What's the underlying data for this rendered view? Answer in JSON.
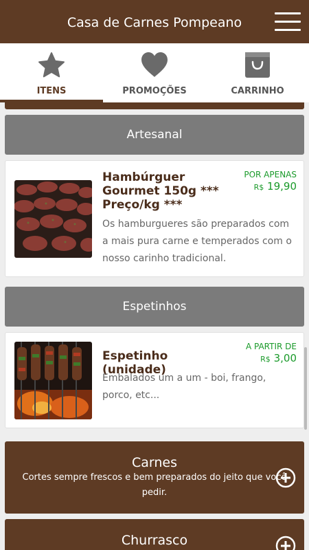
{
  "header": {
    "title": "Casa de Carnes Pompeano",
    "menu_icon": "hamburger-menu-icon"
  },
  "tabs": [
    {
      "label": "ITENS",
      "icon": "star-icon",
      "active": true
    },
    {
      "label": "PROMOÇÕES",
      "icon": "heart-icon",
      "active": false
    },
    {
      "label": "CARRINHO",
      "icon": "shopping-bag-icon",
      "active": false
    }
  ],
  "sections": [
    {
      "title": "Artesanal",
      "products": [
        {
          "name": "Hambúrguer Gourmet 150g *** Preço/kg ***",
          "price_label": "POR APENAS",
          "currency": "R$",
          "price": "19,90",
          "description": "Os hamburgueres são preparados com a mais pura carne e temperados com o nosso carinho tradicional."
        }
      ]
    },
    {
      "title": "Espetinhos",
      "products": [
        {
          "name": "Espetinho (unidade)",
          "price_label": "A PARTIR DE",
          "currency": "R$",
          "price": "3,00",
          "description": "Embalados um a um - boi, frango, porco, etc..."
        }
      ]
    }
  ],
  "categories": [
    {
      "name": "Carnes",
      "description": "Cortes sempre frescos e bem preparados do jeito que você pedir."
    },
    {
      "name": "Churrasco",
      "description": ""
    }
  ],
  "colors": {
    "brand": "#5e3b24",
    "section": "#7b7b7b",
    "price": "#1a9a2a"
  }
}
